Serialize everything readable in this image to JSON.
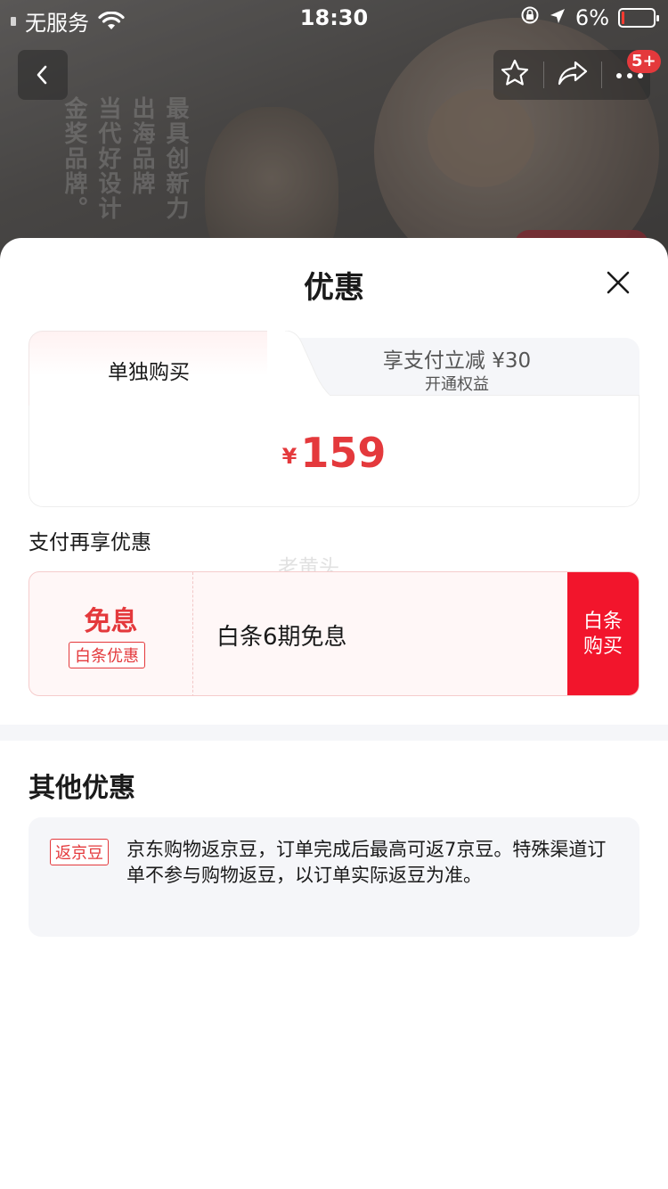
{
  "status_bar": {
    "carrier": "无服务",
    "time": "18:30",
    "battery_percent": "6%",
    "battery_level": 0.06
  },
  "background": {
    "vertical_text": [
      "最具创新力",
      "出海品牌",
      "当代好设计",
      "金奖品牌。"
    ]
  },
  "nav": {
    "cart_badge": "5+"
  },
  "sheet": {
    "title": "优惠",
    "tabs": [
      {
        "label": "单独购买",
        "active": true
      },
      {
        "label": "享支付立减 ¥30",
        "sub_label": "开通权益",
        "active": false
      }
    ],
    "price_symbol": "¥",
    "price": "159",
    "pay_section_title": "支付再享优惠",
    "watermark": "老黄头",
    "installment": {
      "headline": "免息",
      "tag": "白条优惠",
      "description": "白条6期免息",
      "button_label": "白条购买"
    },
    "other_title": "其他优惠",
    "other_offer": {
      "tag": "返京豆",
      "text": "京东购物返京豆，订单完成后最高可返7京豆。特殊渠道订单不参与购物返豆，以订单实际返豆为准。"
    }
  },
  "colors": {
    "accent": "#e4393c",
    "buy_button": "#f2152c",
    "card_bg": "#f5f6f9"
  }
}
